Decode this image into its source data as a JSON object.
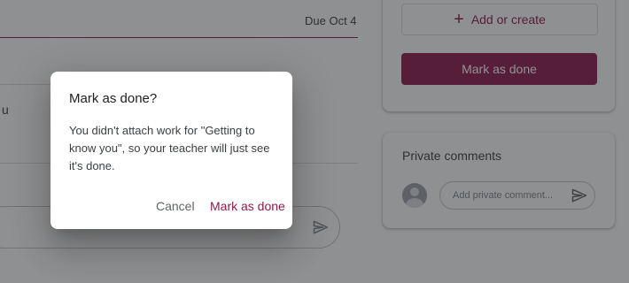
{
  "assignment": {
    "due": "Due Oct 4",
    "partial_text": "u"
  },
  "work_card": {
    "add_or_create_label": "Add or create",
    "mark_as_done_label": "Mark as done"
  },
  "private_comments": {
    "title": "Private comments",
    "placeholder": "Add private comment..."
  },
  "dialog": {
    "title": "Mark as done?",
    "body": "You didn't attach work for \"Getting to know you\", so your teacher will just see it's done.",
    "cancel_label": "Cancel",
    "confirm_label": "Mark as done"
  },
  "colors": {
    "accent": "#8e1b4e",
    "scrim": "rgba(32,33,36,0.5)"
  },
  "icons": {
    "add": "plus-icon",
    "send": "send-icon",
    "avatar": "avatar-icon"
  }
}
